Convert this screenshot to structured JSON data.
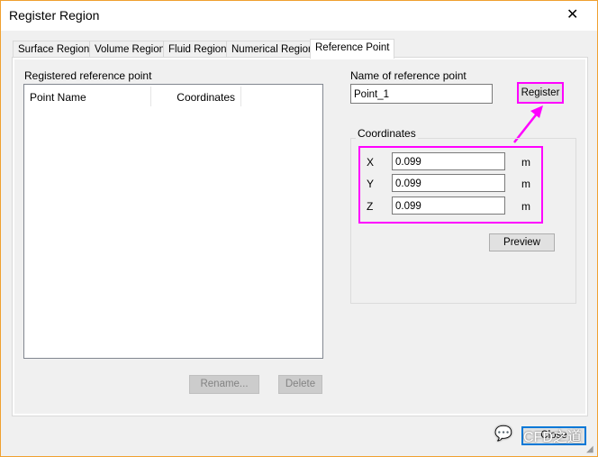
{
  "window": {
    "title": "Register Region",
    "close_icon": "close-icon"
  },
  "tabs": [
    {
      "label": "Surface Region"
    },
    {
      "label": "Volume Region"
    },
    {
      "label": "Fluid Region"
    },
    {
      "label": "Numerical Region"
    },
    {
      "label": "Reference Point",
      "active": true
    }
  ],
  "list": {
    "label": "Registered reference point",
    "columns": [
      "Point Name",
      "Coordinates"
    ],
    "rows": []
  },
  "name": {
    "label": "Name of reference point",
    "value": "Point_1"
  },
  "register_label": "Register",
  "coordinates": {
    "label": "Coordinates",
    "rows": [
      {
        "axis": "X",
        "value": "0.099",
        "unit": "m"
      },
      {
        "axis": "Y",
        "value": "0.099",
        "unit": "m"
      },
      {
        "axis": "Z",
        "value": "0.099",
        "unit": "m"
      }
    ]
  },
  "preview_label": "Preview",
  "rename_label": "Rename...",
  "delete_label": "Delete",
  "close_label": "Close",
  "watermark": "CFD之道",
  "highlight_color": "#ff00ff"
}
